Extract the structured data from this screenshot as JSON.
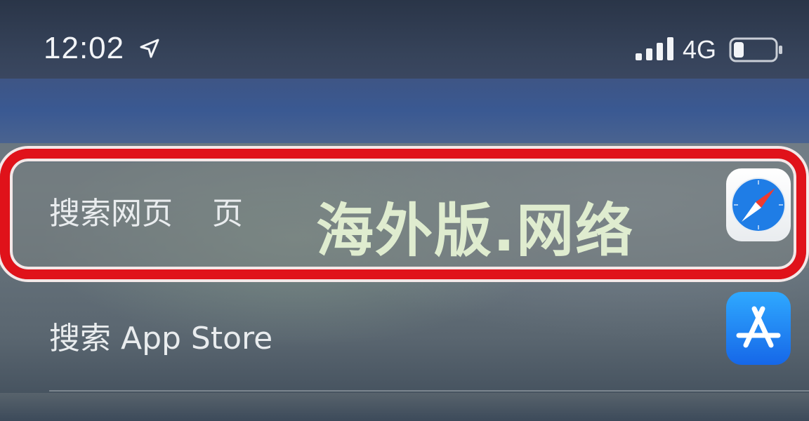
{
  "status_bar": {
    "time": "12:02",
    "network": "4G",
    "icons": [
      "location-arrow-icon",
      "cellular-signal-icon",
      "battery-icon"
    ]
  },
  "results": [
    {
      "label": "搜索网页    页",
      "icon": "safari-compass-icon",
      "highlighted": true
    },
    {
      "label": "搜索 App Store",
      "icon": "app-store-icon",
      "highlighted": false
    }
  ],
  "overlay": {
    "watermark": "海外版.网络"
  },
  "colors": {
    "highlight_border": "#e0121a",
    "status_bar_bg": "#2a3548",
    "blue_band": "#3a5992",
    "app_store_blue": "#1a79f0"
  },
  "battery_level": 0.25
}
